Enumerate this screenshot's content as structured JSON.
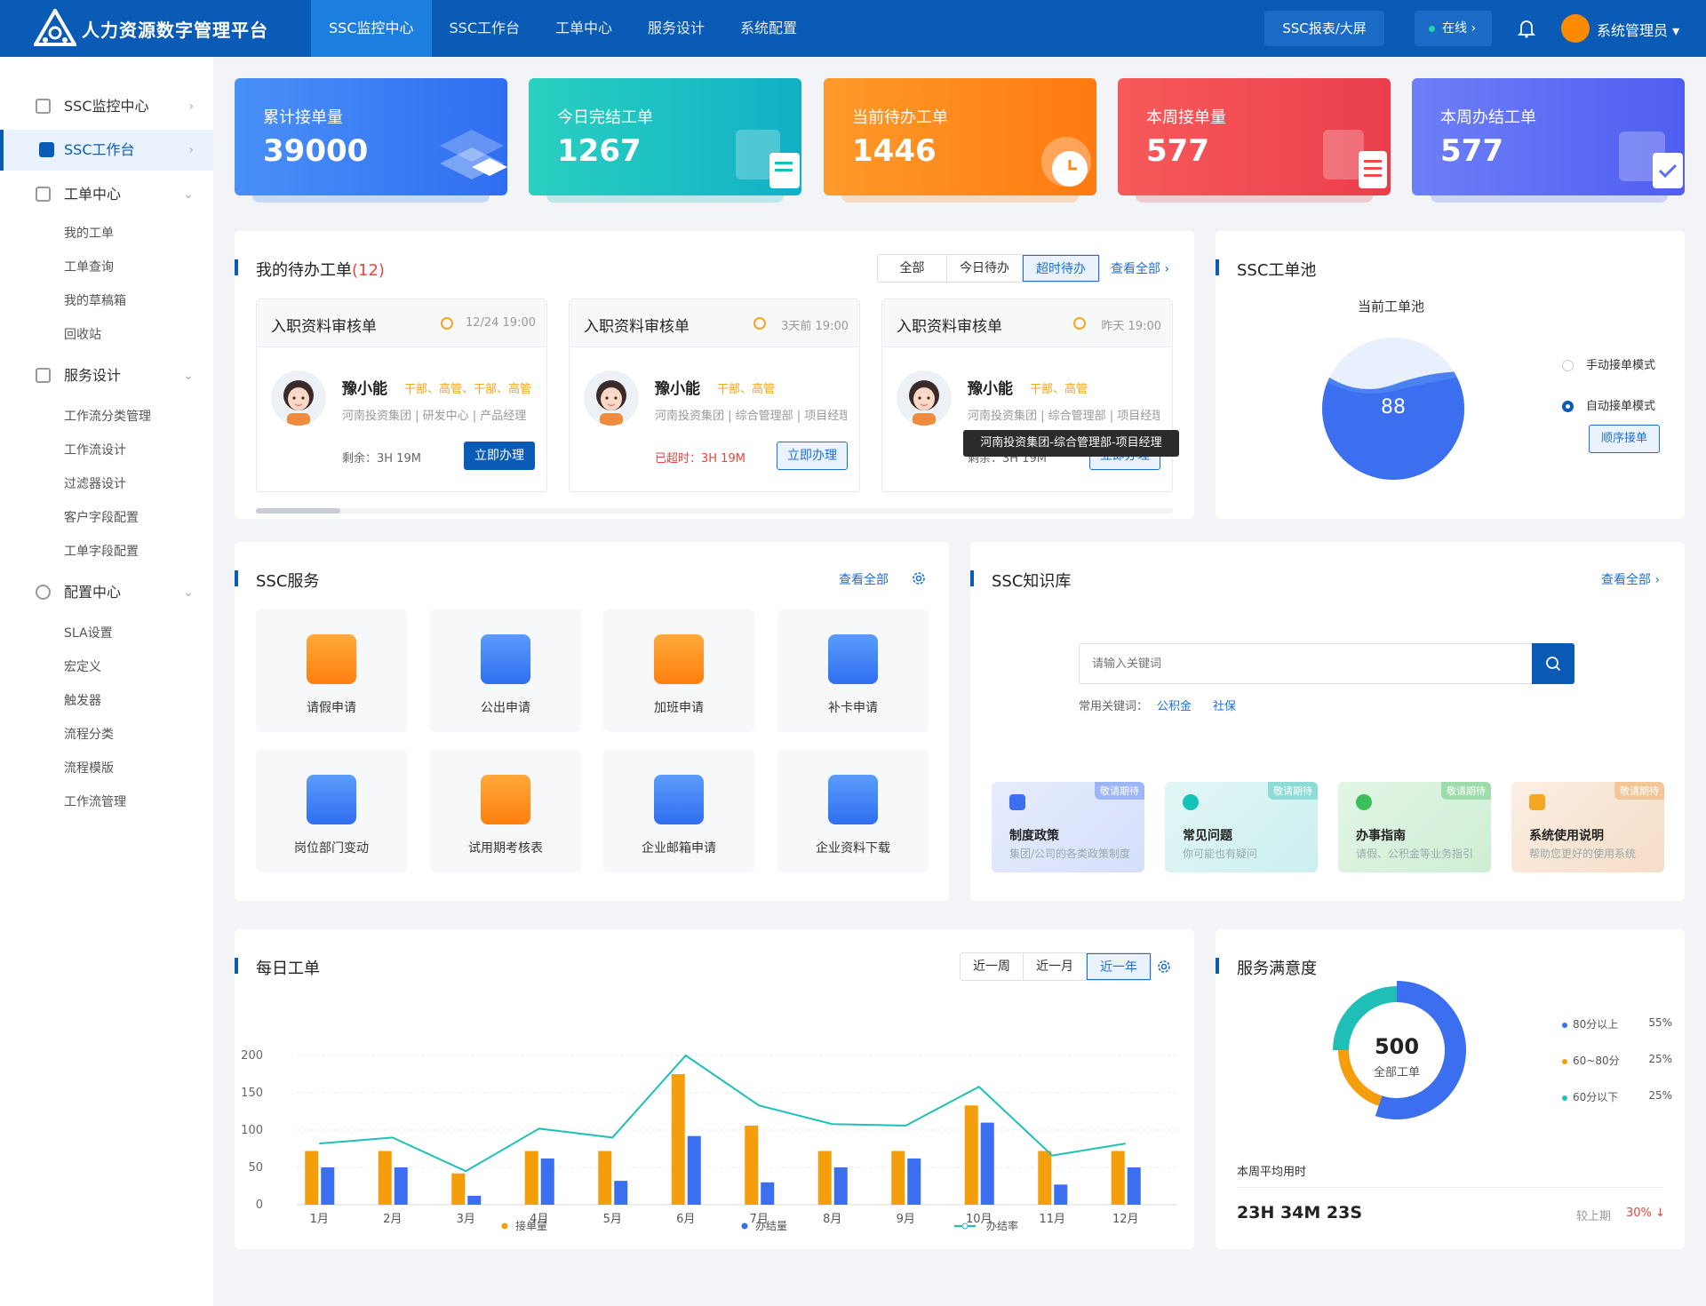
{
  "header": {
    "app_title": "人力资源数字管理平台",
    "nav": [
      "SSC监控中心",
      "SSC工作台",
      "工单中心",
      "服务设计",
      "系统配置"
    ],
    "report_btn": "SSC报表/大屏",
    "status": "在线 ›",
    "user": "系统管理员 ▾"
  },
  "sidebar": {
    "items": [
      {
        "label": "SSC监控中心",
        "arrow": "›"
      },
      {
        "label": "SSC工作台",
        "arrow": "›"
      },
      {
        "label": "工单中心",
        "arrow": "⌄"
      },
      {
        "label": "服务设计",
        "arrow": "⌄"
      },
      {
        "label": "配置中心",
        "arrow": "⌄"
      }
    ],
    "ticket_subs": [
      "我的工单",
      "工单查询",
      "我的草稿箱",
      "回收站"
    ],
    "design_subs": [
      "工作流分类管理",
      "工作流设计",
      "过滤器设计",
      "客户字段配置",
      "工单字段配置"
    ],
    "config_subs": [
      "SLA设置",
      "宏定义",
      "触发器",
      "流程分类",
      "流程模版",
      "工作流管理"
    ]
  },
  "stats": [
    {
      "label": "累计接单量",
      "value": "39000",
      "color": "#3b82f6"
    },
    {
      "label": "今日完结工单",
      "value": "1267",
      "color": "#14c3b8"
    },
    {
      "label": "当前待办工单",
      "value": "1446",
      "color": "#ff8a16"
    },
    {
      "label": "本周接单量",
      "value": "577",
      "color": "#ef4a52"
    },
    {
      "label": "本周办结工单",
      "value": "577",
      "color": "#5b6ef5"
    }
  ],
  "todo": {
    "title": "我的待办工单",
    "count": "(12)",
    "filters": [
      "全部",
      "今日待办",
      "超时待办"
    ],
    "view_all": "查看全部 ›",
    "tasks": [
      {
        "name": "入职资料审核单",
        "time": "12/24 19:00",
        "person": "豫小能",
        "tags": "干部、高管、干部、高管",
        "org": "河南投资集团 | 研发中心 | 产品经理",
        "remain": "剩余：3H 19M",
        "btn": "立即办理"
      },
      {
        "name": "入职资料审核单",
        "time": "3天前 19:00",
        "person": "豫小能",
        "tags": "干部、高管",
        "org": "河南投资集团 | 综合管理部 | 项目经理",
        "remain": "已超时：3H 19M",
        "btn": "立即办理"
      },
      {
        "name": "入职资料审核单",
        "time": "昨天 19:00",
        "person": "豫小能",
        "tags": "干部、高管",
        "org": "河南投资集团 | 综合管理部 | 项目经理",
        "remain": "剩余：3H 19M",
        "btn": "立即办理"
      }
    ],
    "tooltip": "河南投资集团-综合管理部-项目经理"
  },
  "pool": {
    "title": "SSC工单池",
    "subtitle": "当前工单池",
    "value": "88",
    "modes": [
      "手动接单模式",
      "自动接单模式"
    ],
    "order_btn": "顺序接单"
  },
  "services": {
    "title": "SSC服务",
    "view_all": "查看全部",
    "items": [
      {
        "label": "请假申请",
        "color": "#ff8a16"
      },
      {
        "label": "公出申请",
        "color": "#3b82f6"
      },
      {
        "label": "加班申请",
        "color": "#ff8a16"
      },
      {
        "label": "补卡申请",
        "color": "#3b82f6"
      },
      {
        "label": "岗位部门变动",
        "color": "#3b82f6"
      },
      {
        "label": "试用期考核表",
        "color": "#ff8a16"
      },
      {
        "label": "企业邮箱申请",
        "color": "#3b82f6"
      },
      {
        "label": "企业资料下载",
        "color": "#3b82f6"
      }
    ]
  },
  "kb": {
    "title": "SSC知识库",
    "view_all": "查看全部 ›",
    "search_placeholder": "请输入关键词",
    "hot_label": "常用关键词：",
    "hot": [
      "公积金",
      "社保"
    ],
    "cards": [
      {
        "title": "制度政策",
        "desc": "集团/公司的各类政策制度",
        "badge": "敬请期待",
        "color": "#e3e9fb"
      },
      {
        "title": "常见问题",
        "desc": "你可能也有疑问",
        "badge": "敬请期待",
        "color": "#dff5f4"
      },
      {
        "title": "办事指南",
        "desc": "请假、公积金等业务指引",
        "badge": "敬请期待",
        "color": "#e2f5e4"
      },
      {
        "title": "系统使用说明",
        "desc": "帮助您更好的使用系统",
        "badge": "敬请期待",
        "color": "#fbeee2"
      }
    ]
  },
  "daily": {
    "title": "每日工单",
    "ranges": [
      "近一周",
      "近一月",
      "近一年"
    ]
  },
  "chart_data": {
    "type": "bar",
    "categories": [
      "1月",
      "2月",
      "3月",
      "4月",
      "5月",
      "6月",
      "7月",
      "8月",
      "9月",
      "10月",
      "11月",
      "12月"
    ],
    "ylim": [
      0,
      200
    ],
    "yticks": [
      0,
      50,
      100,
      150,
      200
    ],
    "series": [
      {
        "name": "接单量",
        "type": "bar",
        "color": "#f59e0b",
        "values": [
          72,
          72,
          42,
          72,
          72,
          175,
          106,
          72,
          72,
          133,
          72,
          72
        ]
      },
      {
        "name": "办结量",
        "type": "bar",
        "color": "#3b6ff0",
        "values": [
          50,
          50,
          12,
          62,
          32,
          92,
          30,
          50,
          62,
          110,
          27,
          50
        ]
      },
      {
        "name": "办结率",
        "type": "line",
        "color": "#1fbfb8",
        "values": [
          82,
          90,
          45,
          102,
          90,
          200,
          133,
          108,
          106,
          158,
          66,
          82
        ]
      }
    ]
  },
  "satisfaction": {
    "title": "服务满意度",
    "total": "500",
    "total_label": "全部工单",
    "slices": [
      {
        "label": "80分以上",
        "pct": "55%",
        "value": 55,
        "color": "#3b6ff0"
      },
      {
        "label": "60~80分",
        "pct": "25%",
        "value": 25,
        "color": "#1fbfb8"
      },
      {
        "label": "60分以下",
        "pct": "25%",
        "value": 20,
        "color": "#f59e0b"
      }
    ],
    "avg_label": "本周平均用时",
    "avg_value": "23H 34M 23S",
    "compare_label": "较上期",
    "compare_value": "30% ↓"
  }
}
